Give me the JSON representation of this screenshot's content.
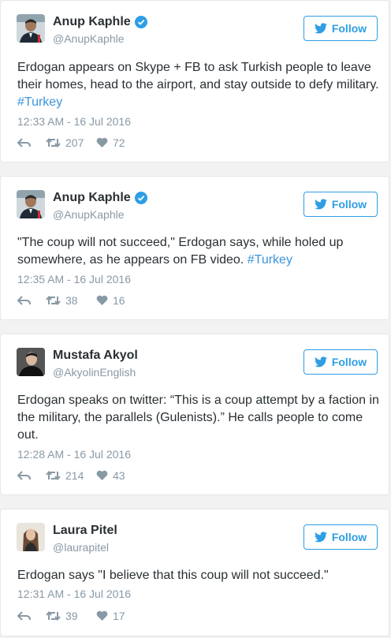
{
  "tweets": [
    {
      "name": "Anup Kaphle",
      "handle": "@AnupKaphle",
      "verified": true,
      "follow_label": "Follow",
      "text": "Erdogan appears on Skype + FB to ask Turkish people to leave their homes, head to the airport, and stay outside to defy military.",
      "hashtag": "#Turkey",
      "timestamp": "12:33 AM - 16 Jul 2016",
      "retweets": "207",
      "likes": "72"
    },
    {
      "name": "Anup Kaphle",
      "handle": "@AnupKaphle",
      "verified": true,
      "follow_label": "Follow",
      "text": "\"The coup will not succeed,\" Erdogan says, while holed up somewhere, as he appears on FB video.",
      "hashtag": "#Turkey",
      "timestamp": "12:35 AM - 16 Jul 2016",
      "retweets": "38",
      "likes": "16"
    },
    {
      "name": "Mustafa Akyol",
      "handle": "@AkyolinEnglish",
      "verified": false,
      "follow_label": "Follow",
      "text": "Erdogan speaks on twitter: “This is a coup attempt by a faction in the military, the parallels (Gulenists).” He calls people to come out.",
      "hashtag": "",
      "timestamp": "12:28 AM - 16 Jul 2016",
      "retweets": "214",
      "likes": "43"
    },
    {
      "name": "Laura Pitel",
      "handle": "@laurapitel",
      "verified": false,
      "follow_label": "Follow",
      "text": "Erdogan says \"I believe that this coup will not succeed.\"",
      "hashtag": "",
      "timestamp": "12:31 AM - 16 Jul 2016",
      "retweets": "39",
      "likes": "17"
    }
  ],
  "colors": {
    "accent": "#2e9ee5",
    "hashtag": "#3b94d9",
    "muted": "#8899a6",
    "text": "#292f33"
  }
}
